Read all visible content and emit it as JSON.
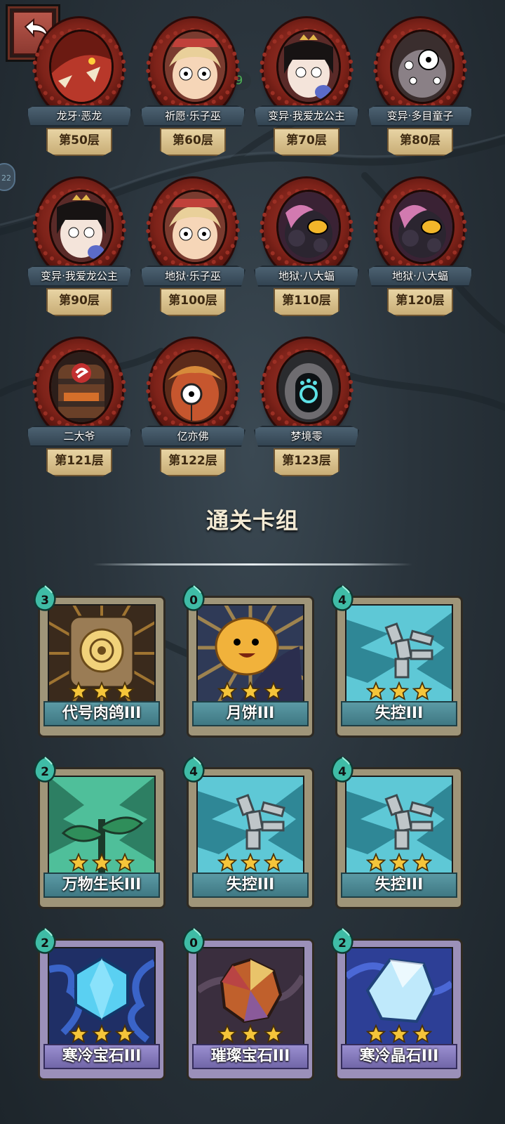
{
  "fps_overlay": "FPS59",
  "side_tab_text": "22",
  "section_title": "通关卡组",
  "bosses": [
    {
      "name": "龙牙·恶龙",
      "floor": "第50层",
      "portrait_icon": "red-dragon-portrait"
    },
    {
      "name": "祈愿·乐子巫",
      "floor": "第60层",
      "portrait_icon": "blonde-witch-portrait"
    },
    {
      "name": "变异·我爱龙公主",
      "floor": "第70层",
      "portrait_icon": "princess-portrait"
    },
    {
      "name": "变异·多目童子",
      "floor": "第80层",
      "portrait_icon": "many-eyed-child-portrait"
    },
    {
      "name": "变异·我爱龙公主",
      "floor": "第90层",
      "portrait_icon": "princess-portrait"
    },
    {
      "name": "地狱·乐子巫",
      "floor": "第100层",
      "portrait_icon": "blonde-witch-portrait"
    },
    {
      "name": "地狱·八大蝠",
      "floor": "第110层",
      "portrait_icon": "bat-beast-portrait"
    },
    {
      "name": "地狱·八大蝠",
      "floor": "第120层",
      "portrait_icon": "bat-beast-portrait"
    },
    {
      "name": "二大爷",
      "floor": "第121层",
      "portrait_icon": "barrel-portrait"
    },
    {
      "name": "亿亦佛",
      "floor": "第122层",
      "portrait_icon": "monocle-creature-portrait"
    },
    {
      "name": "梦境零",
      "floor": "第123层",
      "portrait_icon": "dream-robot-portrait"
    }
  ],
  "cards": [
    {
      "name": "代号肉鸽III",
      "cost": "3",
      "stars": 3,
      "theme": "teal",
      "art_icon": "vault-door-icon"
    },
    {
      "name": "月饼III",
      "cost": "0",
      "stars": 3,
      "theme": "teal",
      "art_icon": "mooncake-icon"
    },
    {
      "name": "失控III",
      "cost": "4",
      "stars": 3,
      "theme": "teal",
      "art_icon": "claw-icon"
    },
    {
      "name": "万物生长III",
      "cost": "2",
      "stars": 3,
      "theme": "teal",
      "art_icon": "sprout-icon"
    },
    {
      "name": "失控III",
      "cost": "4",
      "stars": 3,
      "theme": "teal",
      "art_icon": "claw-icon"
    },
    {
      "name": "失控III",
      "cost": "4",
      "stars": 3,
      "theme": "teal",
      "art_icon": "claw-icon"
    },
    {
      "name": "寒冷宝石III",
      "cost": "2",
      "stars": 3,
      "theme": "purple",
      "art_icon": "ice-gem-icon"
    },
    {
      "name": "璀璨宝石III",
      "cost": "0",
      "stars": 3,
      "theme": "purple",
      "art_icon": "brilliant-gem-icon"
    },
    {
      "name": "寒冷晶石III",
      "cost": "2",
      "stars": 3,
      "theme": "purple",
      "art_icon": "ice-crystal-icon"
    }
  ],
  "colors": {
    "frame_red": "#8d2a20",
    "ribbon": "#405564",
    "plaque": "#dcc794",
    "card_teal": "#4e8b96",
    "card_purple": "#8c82c4",
    "star": "#f5c53a"
  }
}
